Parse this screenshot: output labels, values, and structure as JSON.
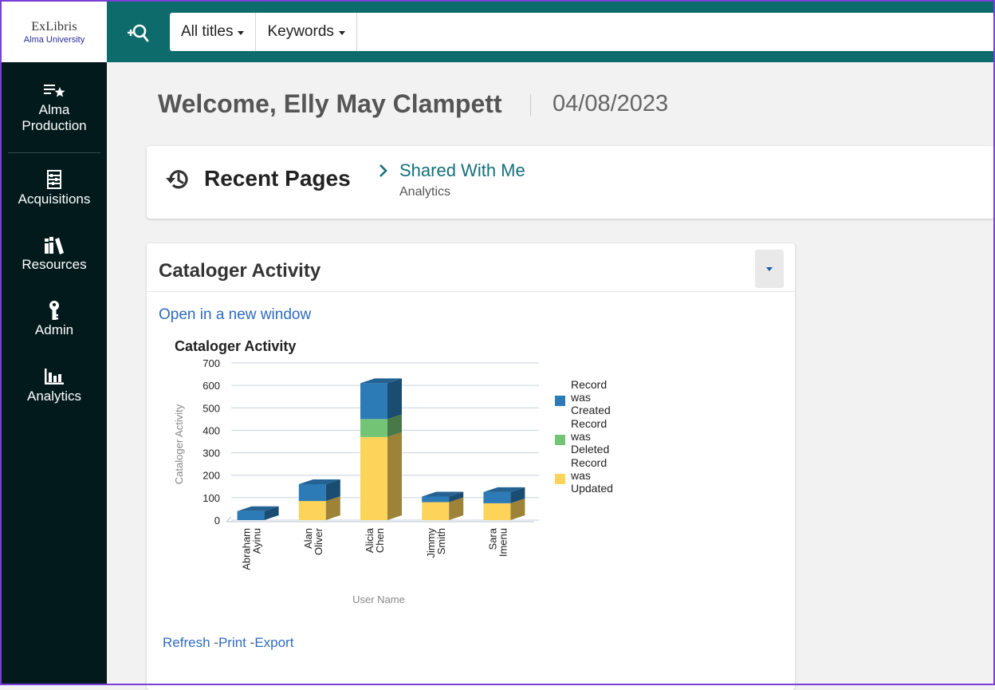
{
  "logo": {
    "main": "ExLibris",
    "sub": "Alma University"
  },
  "search": {
    "scope": "All titles",
    "field": "Keywords",
    "placeholder": ""
  },
  "sidebar": {
    "items": [
      {
        "label_line1": "Alma",
        "label_line2": "Production",
        "icon": "star-list-icon"
      },
      {
        "label": "Acquisitions",
        "icon": "abacus-icon"
      },
      {
        "label": "Resources",
        "icon": "books-icon"
      },
      {
        "label": "Admin",
        "icon": "key-icon"
      },
      {
        "label": "Analytics",
        "icon": "bar-chart-icon"
      }
    ]
  },
  "welcome": {
    "greeting": "Welcome, Elly May Clampett",
    "date": "04/08/2023"
  },
  "recent": {
    "title": "Recent Pages",
    "link_label": "Shared With Me",
    "link_sub": "Analytics"
  },
  "cataloger": {
    "card_title": "Cataloger Activity",
    "open_link": "Open in a new window",
    "footer": {
      "refresh": "Refresh",
      "print": "Print",
      "export": "Export"
    }
  },
  "colors": {
    "created": "#2c7bb6",
    "deleted": "#74c476",
    "updated": "#fdd35a"
  },
  "chart_data": {
    "type": "bar",
    "title": "Cataloger Activity",
    "xlabel": "User Name",
    "ylabel": "Cataloger Activity",
    "ylim": [
      0,
      700
    ],
    "yticks": [
      0,
      100,
      200,
      300,
      400,
      500,
      600,
      700
    ],
    "grid": true,
    "stacked": true,
    "legend_position": "right",
    "categories": [
      [
        "Abraham",
        "Ayinu"
      ],
      [
        "Alan",
        "Oliver"
      ],
      [
        "Alicia",
        "Chen"
      ],
      [
        "Jimmy",
        "Smith"
      ],
      [
        "Sara",
        "Imenu"
      ]
    ],
    "series": [
      {
        "name": [
          "Record",
          "was",
          "Updated"
        ],
        "color": "#fdd35a",
        "values": [
          0,
          85,
          370,
          80,
          75
        ]
      },
      {
        "name": [
          "Record",
          "was",
          "Deleted"
        ],
        "color": "#74c476",
        "values": [
          0,
          0,
          80,
          0,
          0
        ]
      },
      {
        "name": [
          "Record",
          "was",
          "Created"
        ],
        "color": "#2c7bb6",
        "values": [
          40,
          75,
          160,
          25,
          50
        ]
      }
    ],
    "legend_order": [
      2,
      1,
      0
    ]
  }
}
